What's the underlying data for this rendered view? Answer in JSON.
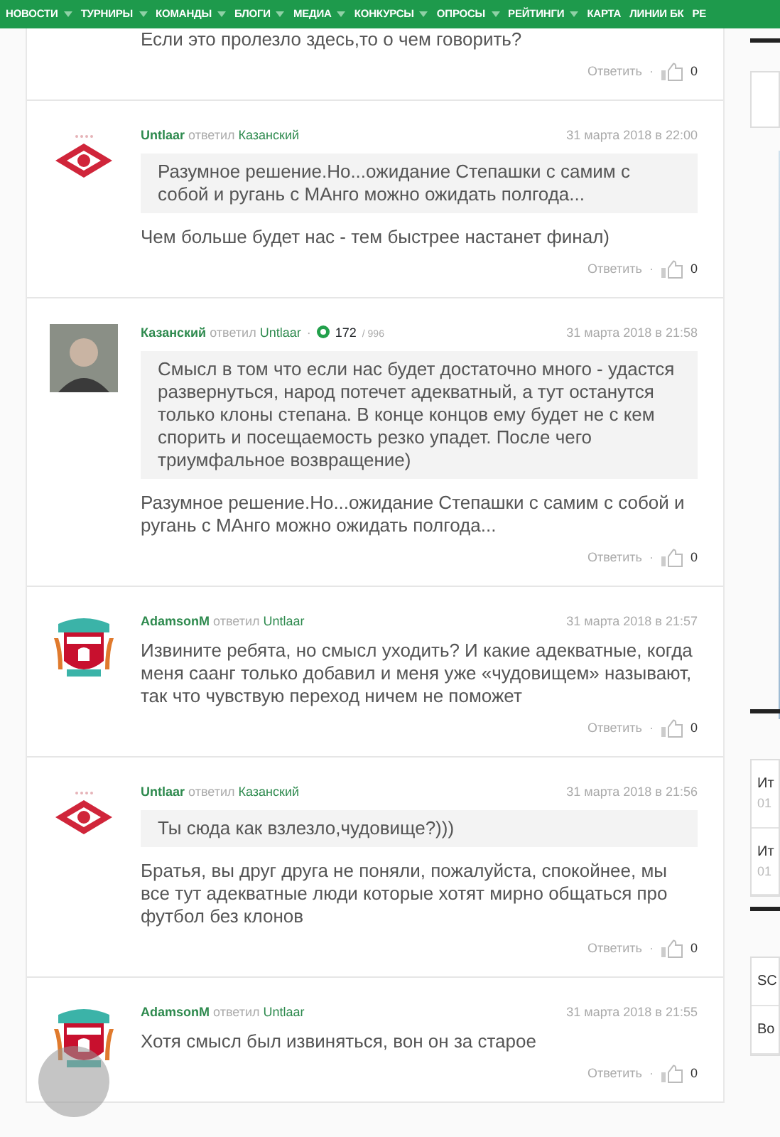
{
  "nav": {
    "items": [
      {
        "label": "НОВОСТИ",
        "has_menu": true
      },
      {
        "label": "ТУРНИРЫ",
        "has_menu": true
      },
      {
        "label": "КОМАНДЫ",
        "has_menu": true
      },
      {
        "label": "БЛОГИ",
        "has_menu": true
      },
      {
        "label": "МЕДИА",
        "has_menu": true
      },
      {
        "label": "КОНКУРСЫ",
        "has_menu": true
      },
      {
        "label": "ОПРОСЫ",
        "has_menu": true
      },
      {
        "label": "РЕЙТИНГИ",
        "has_menu": true
      },
      {
        "label": "КАРТА",
        "has_menu": false
      },
      {
        "label": "ЛИНИИ БК",
        "has_menu": false
      },
      {
        "label": "РЕ",
        "has_menu": false
      }
    ]
  },
  "comments": [
    {
      "text": "Если это пролезло здесь,то о чем говорить?",
      "reply_label": "Ответить",
      "separator": "·",
      "likes": "0"
    },
    {
      "kind": "spartak",
      "author": "Untlaar",
      "replied": "ответил",
      "replied_to": "Казанский",
      "date": "31 марта 2018 в 22:00",
      "quote": "Разумное решение.Но...ожидание Степашки с самим с собой и ругань с МАнго можно ожидать полгода...",
      "text": "Чем больше будет нас - тем быстрее настанет финал)",
      "reply_label": "Ответить",
      "separator": "·",
      "likes": "0"
    },
    {
      "kind": "photo",
      "author": "Казанский",
      "replied": "ответил",
      "replied_to": "Untlaar",
      "rating_separator": "·",
      "rating": "172",
      "rating_total": "/ 996",
      "date": "31 марта 2018 в 21:58",
      "quote": "Смысл в том что если нас будет достаточно много - удастся развернуться, народ потечет адекватный, а тут останутся только клоны степана. В конце концов ему будет не с кем спорить и посещаемость резко упадет. После чего триумфальное возвращение)",
      "text": "Разумное решение.Но...ожидание Степашки с самим с собой и ругань с МАнго можно ожидать полгода...",
      "reply_label": "Ответить",
      "separator": "·",
      "likes": "0"
    },
    {
      "kind": "liverpool",
      "author": "AdamsonM",
      "replied": "ответил",
      "replied_to": "Untlaar",
      "date": "31 марта 2018 в 21:57",
      "text": "Извините ребята, но смысл уходить? И какие адекватные, когда меня саанг только добавил и меня уже «чудовищем» называют, так что чувствую переход ничем не поможет",
      "reply_label": "Ответить",
      "separator": "·",
      "likes": "0"
    },
    {
      "kind": "spartak",
      "author": "Untlaar",
      "replied": "ответил",
      "replied_to": "Казанский",
      "date": "31 марта 2018 в 21:56",
      "quote": "Ты сюда как взлезло,чудовище?)))",
      "text": "Братья, вы друг друга не поняли, пожалуйста, спокойнее, мы все тут адекватные люди которые хотят мирно общаться про футбол без клонов",
      "reply_label": "Ответить",
      "separator": "·",
      "likes": "0"
    },
    {
      "kind": "liverpool",
      "author": "AdamsonM",
      "replied": "ответил",
      "replied_to": "Untlaar",
      "date": "31 марта 2018 в 21:55",
      "text": "Хотя смысл был извиняться, вон он за старое",
      "reply_label": "Ответить",
      "separator": "·",
      "likes": "0"
    }
  ],
  "sidebar": {
    "blocks": [
      {
        "kind": "empty"
      },
      {
        "kind": "image"
      },
      {
        "kind": "list",
        "items": [
          {
            "title": "Ит",
            "sub": "01"
          },
          {
            "title": "Ит",
            "sub": "01"
          }
        ]
      },
      {
        "kind": "list",
        "items": [
          {
            "title": "SC"
          },
          {
            "title": "Во"
          }
        ]
      }
    ]
  },
  "scroll_top_button": true
}
